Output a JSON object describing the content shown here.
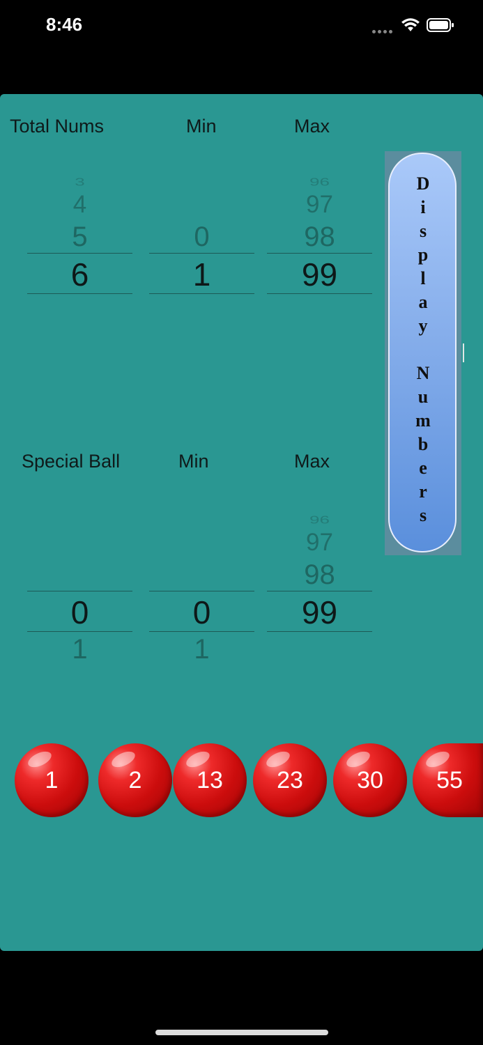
{
  "status_bar": {
    "time": "8:46"
  },
  "top_section": {
    "labels": {
      "total": "Total Nums",
      "min": "Min",
      "max": "Max"
    },
    "pickers": {
      "total": {
        "above3": "3",
        "above2": "4",
        "above1": "5",
        "selected": "6"
      },
      "min": {
        "above1": "0",
        "selected": "1"
      },
      "max": {
        "above3": "96",
        "above2": "97",
        "above1": "98",
        "selected": "99"
      }
    }
  },
  "bottom_section": {
    "labels": {
      "special": "Special Ball",
      "min": "Min",
      "max": "Max"
    },
    "pickers": {
      "special": {
        "selected": "0",
        "below1": "1"
      },
      "min": {
        "selected": "0",
        "below1": "1"
      },
      "max": {
        "above3": "96",
        "above2": "97",
        "above1": "98",
        "selected": "99"
      }
    }
  },
  "display_button": {
    "letters": [
      "D",
      "i",
      "s",
      "p",
      "l",
      "a",
      "y",
      " ",
      "N",
      "u",
      "m",
      "b",
      "e",
      "r",
      "s"
    ]
  },
  "balls": [
    "1",
    "2",
    "13",
    "23",
    "30",
    "55"
  ],
  "colors": {
    "panel": "#2a9792",
    "ball": "#cc0d0d",
    "button": "#86aeeb"
  }
}
